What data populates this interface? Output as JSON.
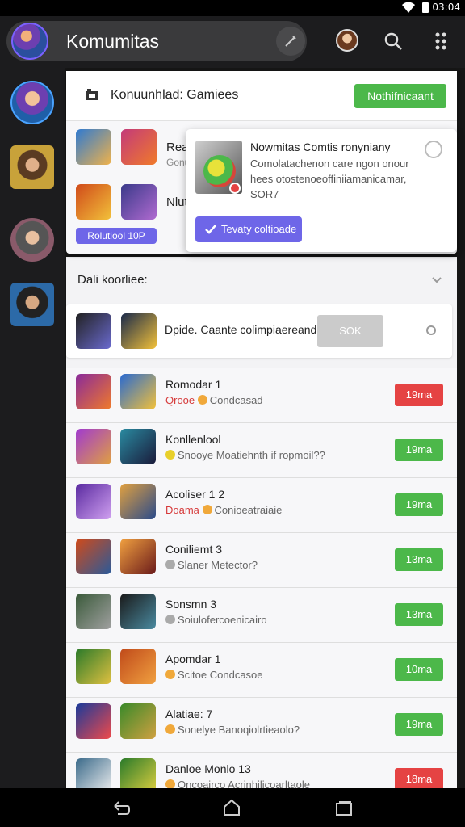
{
  "status_bar": {
    "time": "03:04"
  },
  "app": {
    "title": "Komumitas"
  },
  "header_card": {
    "title": "Konuunhlad: Gamiees",
    "notify_button": "Nothifnicaant"
  },
  "mini_rows": [
    {
      "label": "Rea",
      "sub": "Gonu"
    },
    {
      "label": "Nlut",
      "sub": ""
    }
  ],
  "purple_badge": "Rolutiool 10P",
  "popup": {
    "title": "Nowmitas Comtis ronyniany",
    "body": "Comolatachenon care ngon onour hees otostenoeoffiniiamanicamar, SOR7",
    "action": "Tevaty coltioade"
  },
  "section": {
    "title": "Dali koorliee:"
  },
  "featured": {
    "text": "Dpide. Caante colimpiaereand",
    "button": "SOK"
  },
  "rows": [
    {
      "name": "Romodar 1",
      "tag": "Qrooe",
      "dot": "o",
      "meta": "Condcasad",
      "button": "19ma",
      "color": "red"
    },
    {
      "name": "Konllenlool",
      "tag": "",
      "dot": "y",
      "meta": "Snooye Moatiehnth if ropmoil??",
      "button": "19ma",
      "color": "green"
    },
    {
      "name": "Acoliser 1 2",
      "tag": "Doama",
      "dot": "o",
      "meta": "Conioeatraiaie",
      "button": "19ma",
      "color": "green"
    },
    {
      "name": "Coniliemt 3",
      "tag": "",
      "dot": "g",
      "meta": "Slaner  Metector?",
      "button": "13ma",
      "color": "green"
    },
    {
      "name": "Sonsmn 3",
      "tag": "",
      "dot": "g",
      "meta": "Soiulofercoenicairo",
      "button": "13ma",
      "color": "green"
    },
    {
      "name": "Apomdar 1",
      "tag": "",
      "dot": "o",
      "meta": "Scitoe  Condcasoe",
      "button": "10ma",
      "color": "green"
    },
    {
      "name": "Alatiae: 7",
      "tag": "",
      "dot": "o",
      "meta": "Sonelye Banoqiolrtieaolo?",
      "button": "19ma",
      "color": "green"
    },
    {
      "name": "Danloe Monlo 13",
      "tag": "",
      "dot": "o",
      "meta": "Oncoairco Acrinhilicoarltaole",
      "button": "18ma",
      "color": "red"
    }
  ],
  "colors": {
    "accent_green": "#4cb84a",
    "accent_red": "#e54343",
    "accent_purple": "#6e66e8"
  },
  "icons": [
    "search-icon",
    "tools-icon",
    "grid-menu-icon",
    "check-icon",
    "close-icon",
    "chevron-down-icon",
    "back-icon",
    "home-icon",
    "recents-icon",
    "wifi-icon",
    "battery-icon",
    "flag-icon"
  ]
}
